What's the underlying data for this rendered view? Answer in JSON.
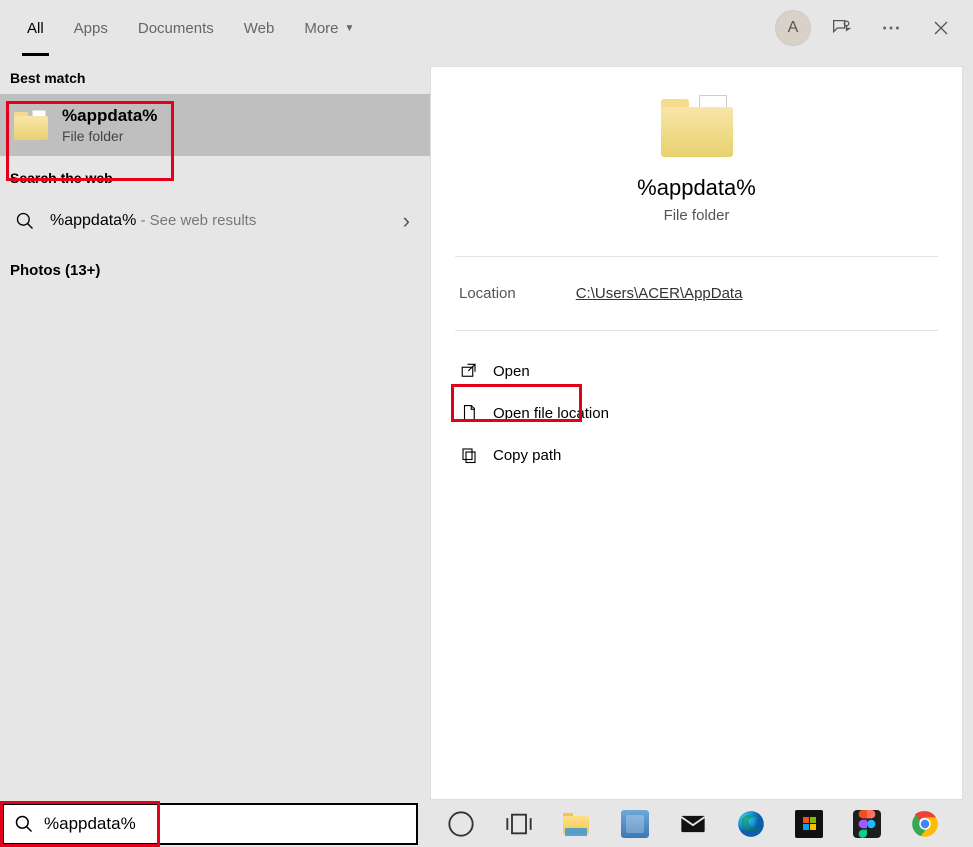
{
  "topbar": {
    "tabs": [
      "All",
      "Apps",
      "Documents",
      "Web",
      "More"
    ],
    "active_tab_index": 0,
    "avatar_letter": "A"
  },
  "left": {
    "best_match_header": "Best match",
    "best_match": {
      "title": "%appdata%",
      "subtitle": "File folder"
    },
    "web_header": "Search the web",
    "web_result": {
      "title": "%appdata%",
      "subtitle": " - See web results"
    },
    "photos_header": "Photos (13+)"
  },
  "preview": {
    "title": "%appdata%",
    "subtitle": "File folder",
    "location_label": "Location",
    "location_path": "C:\\Users\\ACER\\AppData",
    "actions": {
      "open": "Open",
      "open_location": "Open file location",
      "copy_path": "Copy path"
    }
  },
  "search": {
    "value": "%appdata%"
  }
}
